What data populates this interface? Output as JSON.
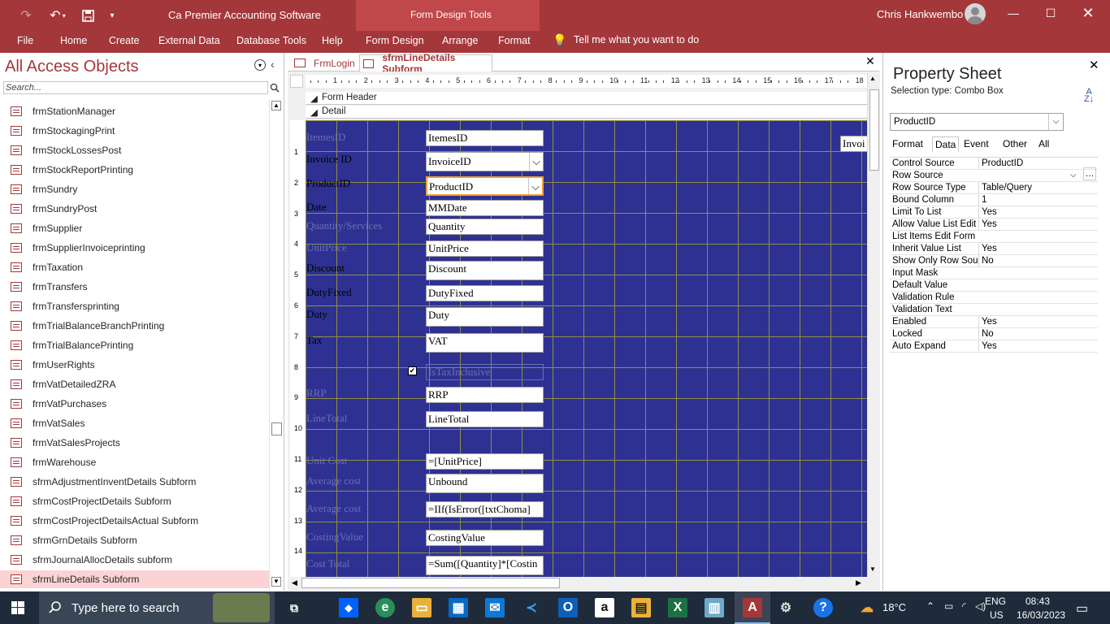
{
  "app": {
    "title": "Ca Premier Accounting Software",
    "context_title": "Form Design Tools",
    "user": "Chris Hankwembo"
  },
  "ribbon_tabs": [
    "File",
    "Home",
    "Create",
    "External Data",
    "Database Tools",
    "Help",
    "Form Design",
    "Arrange",
    "Format"
  ],
  "tell_me": "Tell me what you want to do",
  "nav": {
    "title": "All Access Objects",
    "search_placeholder": "Search...",
    "items": [
      "frmStationManager",
      "frmStockagingPrint",
      "frmStockLossesPost",
      "frmStockReportPrinting",
      "frmSundry",
      "frmSundryPost",
      "frmSupplier",
      "frmSupplierInvoiceprinting",
      "frmTaxation",
      "frmTransfers",
      "frmTransfersprinting",
      "frmTrialBalanceBranchPrinting",
      "frmTrialBalancePrinting",
      "frmUserRights",
      "frmVatDetailedZRA",
      "frmVatPurchases",
      "frmVatSales",
      "frmVatSalesProjects",
      "frmWarehouse",
      "sfrmAdjustmentInventDetails Subform",
      "sfrmCostProjectDetails Subform",
      "sfrmCostProjectDetailsActual Subform",
      "sfrmGrnDetails Subform",
      "sfrmJournalAllocDetails subform",
      "sfrmLineDetails Subform"
    ],
    "selected_index": 24
  },
  "doc_tabs": [
    "FrmLogin",
    "sfrmLineDetails Subform"
  ],
  "ruler": [
    "1",
    "2",
    "3",
    "4",
    "5",
    "6",
    "7",
    "8",
    "9",
    "10",
    "11",
    "12",
    "13",
    "14",
    "15",
    "16",
    "17",
    "18"
  ],
  "vruler": [
    "1",
    "2",
    "3",
    "4",
    "5",
    "6",
    "7",
    "8",
    "9",
    "10",
    "11",
    "12",
    "13",
    "14"
  ],
  "sections": {
    "header": "Form Header",
    "detail": "Detail"
  },
  "form": {
    "labels": [
      "ItemesID",
      "Invoice ID",
      "ProductID",
      "Date",
      "Quantity/Services",
      "UnitPrice",
      "Discount",
      "DutyFixed",
      "Duty",
      "Tax",
      "RRP",
      "LineTotal",
      "Unit Cost",
      "Average cost",
      "Average cost",
      "CostingValue",
      "Cost Total"
    ],
    "fields": [
      "ItemesID",
      "InvoiceID",
      "ProductID",
      "MMDate",
      "Quantity",
      "UnitPrice",
      "Discount",
      "DutyFixed",
      "Duty",
      "VAT",
      "IsTaxInclusive",
      "RRP",
      "LineTotal",
      "=[UnitPrice]",
      "Unbound",
      "=IIf(IsError([txtChoma]",
      "CostingValue",
      "=Sum([Quantity]*[Costin"
    ],
    "right_field": "Invoi"
  },
  "property_sheet": {
    "title": "Property Sheet",
    "selection_type": "Selection type:  Combo Box",
    "object": "ProductID",
    "tabs": [
      "Format",
      "Data",
      "Event",
      "Other",
      "All"
    ],
    "active_tab": "Data",
    "rows": [
      {
        "k": "Control Source",
        "v": "ProductID"
      },
      {
        "k": "Row Source",
        "v": ""
      },
      {
        "k": "Row Source Type",
        "v": "Table/Query"
      },
      {
        "k": "Bound Column",
        "v": "1"
      },
      {
        "k": "Limit To List",
        "v": "Yes"
      },
      {
        "k": "Allow Value List Edit",
        "v": "Yes"
      },
      {
        "k": "List Items Edit Form",
        "v": ""
      },
      {
        "k": "Inherit Value List",
        "v": "Yes"
      },
      {
        "k": "Show Only Row Sou",
        "v": "No"
      },
      {
        "k": "Input Mask",
        "v": ""
      },
      {
        "k": "Default Value",
        "v": ""
      },
      {
        "k": "Validation Rule",
        "v": ""
      },
      {
        "k": "Validation Text",
        "v": ""
      },
      {
        "k": "Enabled",
        "v": "Yes"
      },
      {
        "k": "Locked",
        "v": "No"
      },
      {
        "k": "Auto Expand",
        "v": "Yes"
      }
    ]
  },
  "taskbar": {
    "search_placeholder": "Type here to search",
    "weather": "18°C",
    "lang": "ENG",
    "region": "US",
    "time": "08:43",
    "date": "16/03/2023"
  },
  "colors": {
    "accent": "#a4373a",
    "grid": "#2e3192",
    "selected_nav": "#fcd3d4"
  }
}
